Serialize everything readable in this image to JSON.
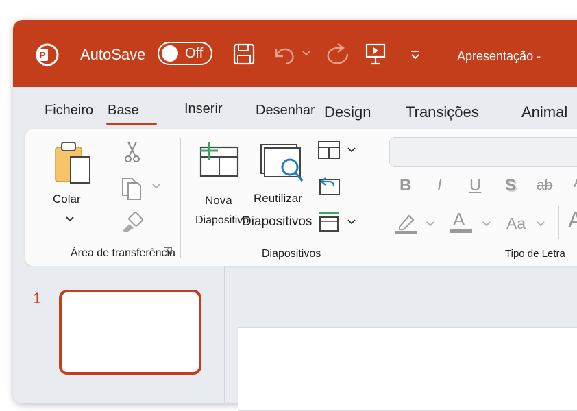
{
  "titlebar": {
    "autosave_label": "AutoSave",
    "autosave_state": "Off",
    "document_title": "Apresentação -",
    "bg_color": "#c43e1c"
  },
  "tabs": [
    {
      "label": "Ficheiro"
    },
    {
      "label": "Base",
      "selected": true
    },
    {
      "label": "Inserir"
    },
    {
      "label": "Desenhar"
    },
    {
      "label": "Design"
    },
    {
      "label": "Transições"
    },
    {
      "label": "Animal"
    }
  ],
  "clipboard": {
    "paste_label": "Colar",
    "group_label": "Área de transferência"
  },
  "slides_group": {
    "new_slide_line1": "Nova",
    "new_slide_line2": "Diapositivo",
    "reuse_line1": "Reutilizar",
    "reuse_line2": "Diapositivos",
    "group_label": "Diapositivos"
  },
  "font_group": {
    "bold": "B",
    "italic": "I",
    "underline": "U",
    "shadow": "S",
    "strikethrough": "ab",
    "spacing": "AV",
    "font_color": "A",
    "change_case": "Aa",
    "grow_font": "A",
    "group_label": "Tipo de Letra"
  },
  "slide_pane": {
    "slide_number": "1"
  },
  "colors": {
    "accent": "#c43e1c",
    "highlight_green": "#3aa757",
    "reuse_blue": "#1d7dc4"
  }
}
